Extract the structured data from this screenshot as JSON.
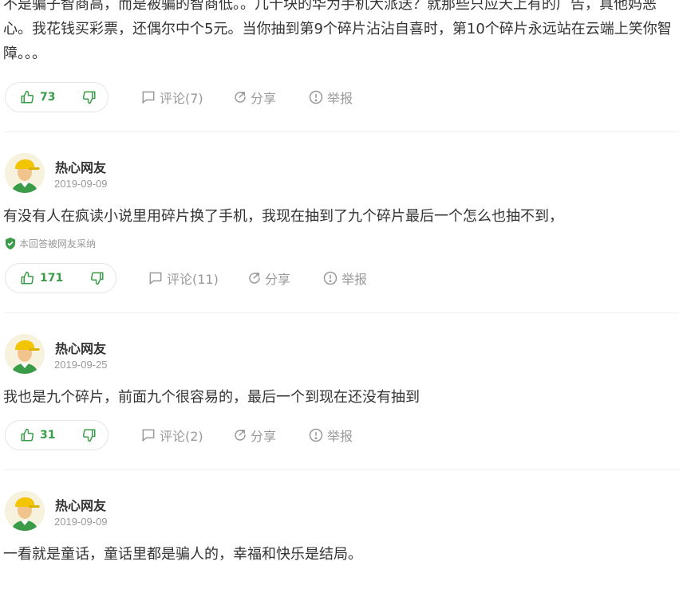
{
  "top_answer": {
    "text": "不是骗子智商高，而是被骗的智商低。。几十块的华为手机大派送？就那些只应天上有的广告，真他妈恶心。我花钱买彩票，还偶尔中个5元。当你抽到第9个碎片沾沾自喜时，第10个碎片永远站在云端上笑你智障。。。",
    "likes": "73",
    "comment_label": "评论(7)",
    "share_label": "分享",
    "report_label": "举报"
  },
  "answers": [
    {
      "user": "热心网友",
      "date": "2019-09-09",
      "text": "有没有人在疯读小说里用碎片换了手机，我现在抽到了九个碎片最后一个怎么也抽不到，",
      "adopted": "本回答被网友采纳",
      "likes": "171",
      "comment_label": "评论(11)",
      "share_label": "分享",
      "report_label": "举报"
    },
    {
      "user": "热心网友",
      "date": "2019-09-25",
      "text": "我也是九个碎片，前面九个很容易的，最后一个到现在还没有抽到",
      "likes": "31",
      "comment_label": "评论(2)",
      "share_label": "分享",
      "report_label": "举报"
    },
    {
      "user": "热心网友",
      "date": "2019-09-09",
      "text": "一看就是童话，童话里都是骗人的，幸福和快乐是结局。"
    }
  ],
  "colors": {
    "accent_green": "#3a9c49",
    "muted_text": "#999999",
    "body_text": "#333333",
    "border": "#e5e5e5"
  },
  "icons": [
    "thumbs-up-icon",
    "thumbs-down-icon",
    "comment-icon",
    "share-icon",
    "report-icon",
    "shield-check-icon",
    "avatar-icon"
  ]
}
